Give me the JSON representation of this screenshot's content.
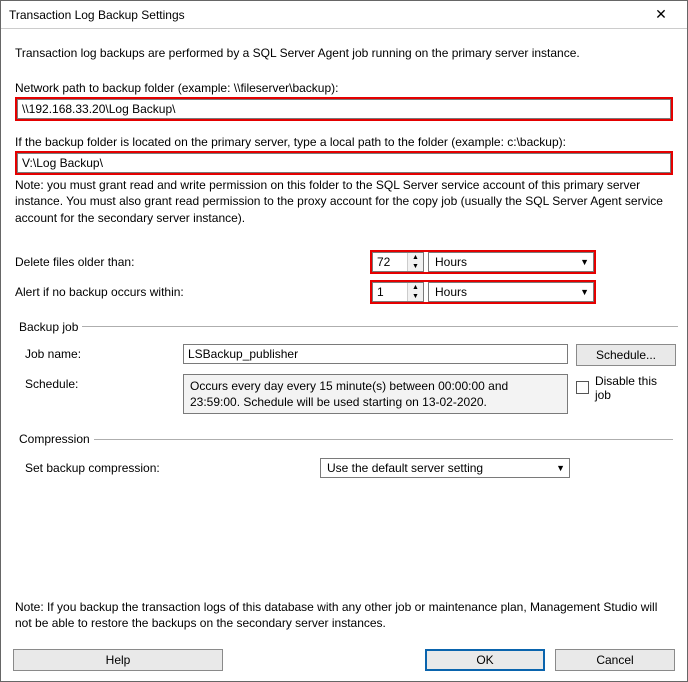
{
  "window": {
    "title": "Transaction Log Backup Settings"
  },
  "intro": "Transaction log backups are performed by a SQL Server Agent job running on the primary server instance.",
  "network_path": {
    "label": "Network path to backup folder (example: \\\\fileserver\\backup):",
    "value": "\\\\192.168.33.20\\Log Backup\\"
  },
  "local_path": {
    "label": "If the backup folder is located on the primary server, type a local path to the folder (example: c:\\backup):",
    "value": "V:\\Log Backup\\"
  },
  "permission_note": "Note: you must grant read and write permission on this folder to the SQL Server service account of this primary server instance.  You must also grant read permission to the proxy account for the copy job (usually the SQL Server Agent service account for the secondary server instance).",
  "delete_older": {
    "label": "Delete files older than:",
    "value": "72",
    "unit": "Hours"
  },
  "alert_if": {
    "label": "Alert if no backup occurs within:",
    "value": "1",
    "unit": "Hours"
  },
  "backup_job": {
    "legend": "Backup job",
    "job_name_label": "Job name:",
    "job_name_value": "LSBackup_publisher",
    "schedule_button": "Schedule...",
    "schedule_label": "Schedule:",
    "schedule_text": "Occurs every day every 15 minute(s) between 00:00:00 and 23:59:00. Schedule will be used starting on 13-02-2020.",
    "disable_label": "Disable this job"
  },
  "compression": {
    "legend": "Compression",
    "label": "Set backup compression:",
    "value": "Use the default server setting"
  },
  "footer_note": "Note: If you backup the transaction logs of this database with any other job or maintenance plan, Management Studio will not be able to restore the backups on the secondary server instances.",
  "buttons": {
    "help": "Help",
    "ok": "OK",
    "cancel": "Cancel"
  }
}
